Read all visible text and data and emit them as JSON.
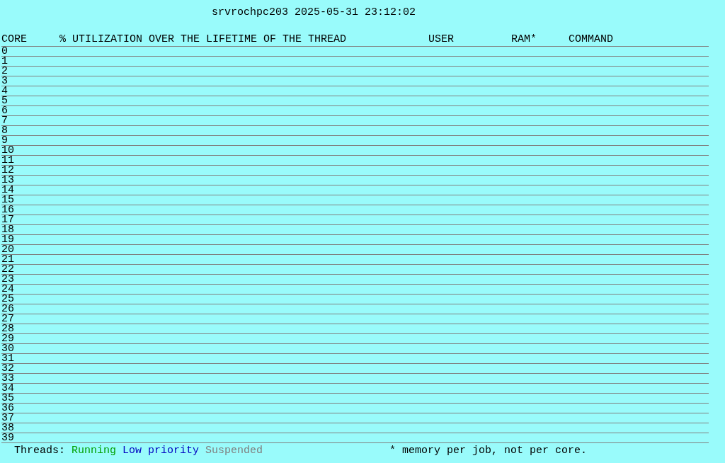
{
  "title": "srvrochpc203 2025-05-31 23:12:02",
  "table": {
    "columns": [
      "CORE",
      "% UTILIZATION OVER THE LIFETIME OF THE THREAD",
      "USER",
      "RAM*",
      "COMMAND"
    ],
    "rows": [
      "0",
      "1",
      "2",
      "3",
      "4",
      "5",
      "6",
      "7",
      "8",
      "9",
      "10",
      "11",
      "12",
      "13",
      "14",
      "15",
      "16",
      "17",
      "18",
      "19",
      "20",
      "21",
      "22",
      "23",
      "24",
      "25",
      "26",
      "27",
      "28",
      "29",
      "30",
      "31",
      "32",
      "33",
      "34",
      "35",
      "36",
      "37",
      "38",
      "39"
    ]
  },
  "legend": {
    "label": "Threads:",
    "items": [
      {
        "label": "Running",
        "color": "#00a000"
      },
      {
        "label": "Low priority",
        "color": "#0000c0"
      },
      {
        "label": "Suspended",
        "color": "#808080"
      }
    ]
  },
  "note": "* memory per job, not per core."
}
